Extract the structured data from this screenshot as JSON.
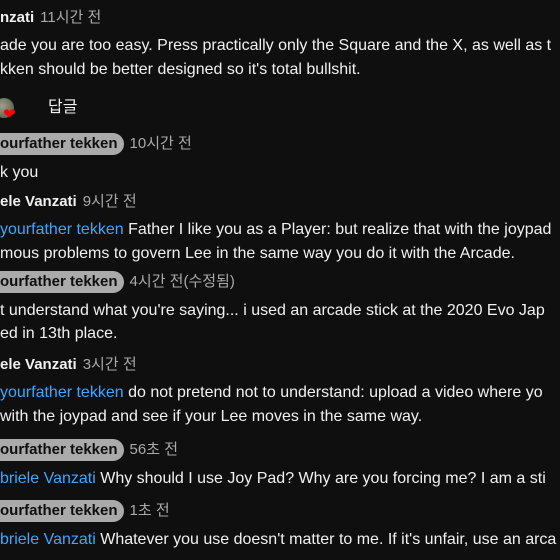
{
  "comment": {
    "author": "nzati",
    "time": "11시간 전",
    "text_line1": "ade you are too easy. Press practically only the Square and the X, as well as t",
    "text_line2": "kken should be better designed so it's total bullshit."
  },
  "actions": {
    "reply_label": "답글"
  },
  "replies": [
    {
      "author": "ourfather tekken",
      "time": "10시간 전",
      "lines": [
        "k you"
      ]
    },
    {
      "author": "ele Vanzati",
      "time": "9시간 전",
      "mention": "yourfather tekken",
      "line1_text": " Father I like you as a Player: but realize that with the joypad",
      "line2": "mous problems to govern Lee in the same way you do it with the Arcade."
    },
    {
      "author": "ourfather tekken",
      "time": "4시간 전(수정됨)",
      "line1": "t understand what you're saying... i used an arcade stick at the 2020 Evo Jap",
      "line2": "ed in 13th place."
    },
    {
      "author": "ele Vanzati",
      "time": "3시간 전",
      "mention": "yourfather tekken",
      "line1_text": "  do not pretend not to understand: upload a video where yo",
      "line2": "with the joypad and see if your Lee moves in the same way."
    },
    {
      "author": "ourfather tekken",
      "time": "56초 전",
      "mention": "briele Vanzati",
      "line1_text": "  Why should I use Joy Pad? Why are you forcing me? I am a sti"
    },
    {
      "author": "ourfather tekken",
      "time": "1초 전",
      "mention": "briele Vanzati",
      "line1_text": " Whatever you use doesn't matter to me. If it's unfair, use an arca"
    }
  ]
}
